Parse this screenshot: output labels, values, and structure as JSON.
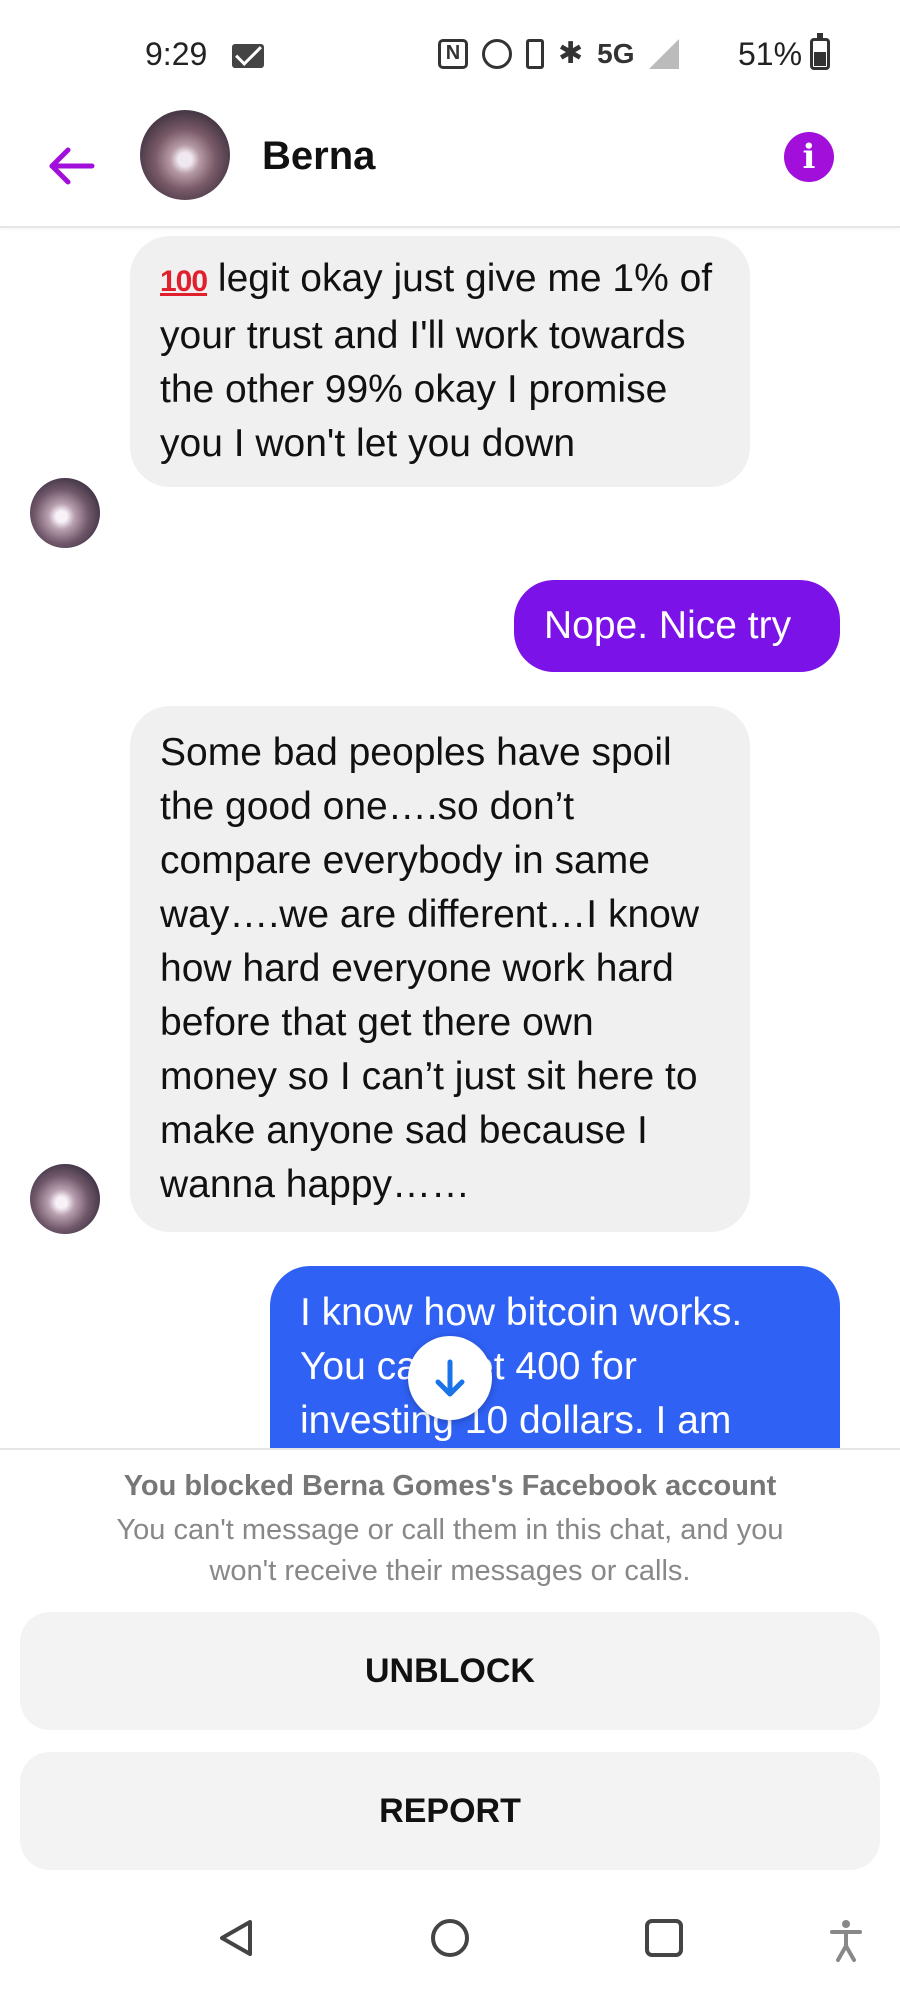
{
  "status_bar": {
    "time": "9:29",
    "network": "5G",
    "battery": "51%",
    "icons": [
      "mail-icon",
      "nfc-icon",
      "alarm-icon",
      "vibrate-icon",
      "bluetooth-icon",
      "signal-icon",
      "battery-icon"
    ]
  },
  "header": {
    "contact_name": "Berna",
    "icons": [
      "back-arrow-icon",
      "contact-avatar",
      "info-icon"
    ],
    "accent_color": "#a20fdb"
  },
  "messages": [
    {
      "direction": "incoming",
      "prefix_emoji": "100",
      "text": "legit okay just give me 1% of your trust and I'll work towards the other 99% okay I promise you I won't let you down"
    },
    {
      "direction": "outgoing",
      "text": "Nope. Nice try",
      "color": "#7b12e8"
    },
    {
      "direction": "incoming",
      "text": "Some bad peoples have spoil the good one….so don’t compare everybody in same way….we are different…I know how hard everyone work hard before that get there own money so I can’t just sit here to make anyone sad because I wanna happy……"
    },
    {
      "direction": "outgoing",
      "lines": [
        "I know how bitcoin works.",
        "You can get 400 for",
        "investing 10 dollars. I am"
      ],
      "color": "#2f61f5"
    }
  ],
  "blocked_panel": {
    "title": "You blocked Berna Gomes's Facebook account",
    "description": "You can't message or call them in this chat, and you won't receive their messages or calls.",
    "unblock_label": "UNBLOCK",
    "report_label": "REPORT"
  },
  "nav_bar": {
    "icons": [
      "back-nav-icon",
      "home-nav-icon",
      "recents-nav-icon",
      "accessibility-icon"
    ]
  }
}
